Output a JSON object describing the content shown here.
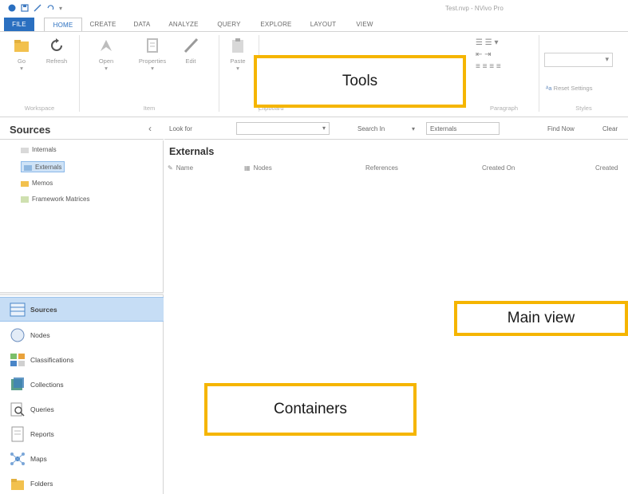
{
  "window": {
    "title": "Test.nvp - NVivo Pro"
  },
  "ribbon_tabs": [
    "FILE",
    "HOME",
    "CREATE",
    "DATA",
    "ANALYZE",
    "QUERY",
    "EXPLORE",
    "LAYOUT",
    "VIEW"
  ],
  "ribbon": {
    "go_label": "Go",
    "refresh_label": "Refresh",
    "workspace_group": "Workspace",
    "open_label": "Open",
    "properties_label": "Properties",
    "edit_label": "Edit",
    "item_group": "Item",
    "paste_label": "Paste",
    "clipboard_group": "Clipboard",
    "paragraph_group": "Paragraph",
    "reset_settings_label": "Reset Settings",
    "styles_group": "Styles"
  },
  "sources_pane": {
    "title": "Sources",
    "tree": [
      "Internals",
      "Externals",
      "Memos",
      "Framework Matrices"
    ],
    "selected": "Externals"
  },
  "nav": {
    "items": [
      "Sources",
      "Nodes",
      "Classifications",
      "Collections",
      "Queries",
      "Reports",
      "Maps",
      "Folders"
    ],
    "active": "Sources"
  },
  "search": {
    "look_for_label": "Look for",
    "look_for_value": "",
    "search_in_label": "Search In",
    "search_in_value": "Externals",
    "find_now_label": "Find Now",
    "clear_label": "Clear"
  },
  "list": {
    "title": "Externals",
    "columns": [
      "Name",
      "Nodes",
      "References",
      "Created On",
      "Created"
    ]
  },
  "callouts": {
    "tools": "Tools",
    "main_view": "Main view",
    "containers": "Containers"
  },
  "colors": {
    "accent_blue": "#2a6fc0",
    "callout_border": "#f5b500",
    "nav_active": "#c6ddf5"
  }
}
